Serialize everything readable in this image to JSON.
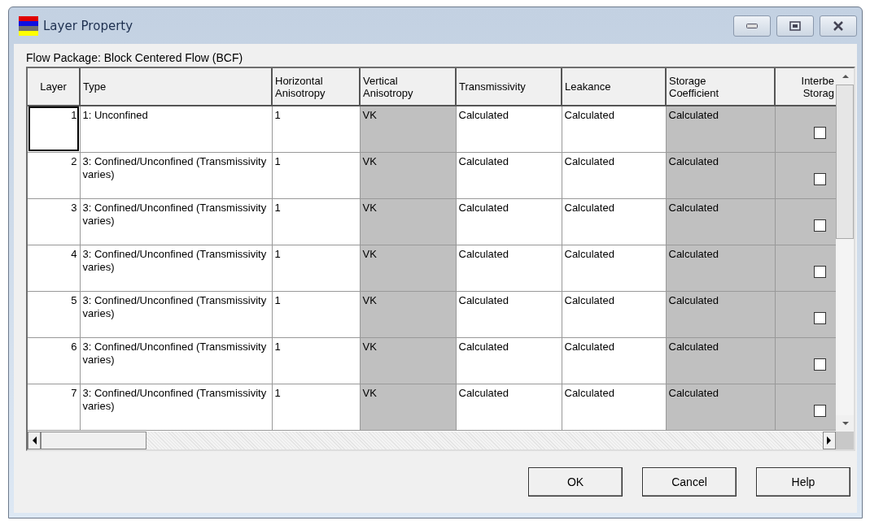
{
  "window": {
    "title": "Layer Property"
  },
  "package_label": "Flow Package: Block Centered Flow (BCF)",
  "table": {
    "columns": [
      {
        "label": "Layer",
        "disabled": false
      },
      {
        "label": "Type",
        "disabled": false
      },
      {
        "label": "Horizontal Anisotropy",
        "disabled": false
      },
      {
        "label": "Vertical Anisotropy",
        "disabled": true
      },
      {
        "label": "Transmissivity",
        "disabled": false
      },
      {
        "label": "Leakance",
        "disabled": false
      },
      {
        "label": "Storage Coefficient",
        "disabled": true
      },
      {
        "label": "Interbe Storag",
        "disabled": true
      }
    ],
    "rows": [
      {
        "layer": "1",
        "focused": true,
        "type": "1: Unconfined",
        "horizontal": "1",
        "vertical": "VK",
        "transmissivity": "Calculated",
        "leakance": "Calculated",
        "storage": "Calculated",
        "interbed": false
      },
      {
        "layer": "2",
        "focused": false,
        "type": "3: Confined/Unconfined (Transmissivity varies)",
        "horizontal": "1",
        "vertical": "VK",
        "transmissivity": "Calculated",
        "leakance": "Calculated",
        "storage": "Calculated",
        "interbed": false
      },
      {
        "layer": "3",
        "focused": false,
        "type": "3: Confined/Unconfined (Transmissivity varies)",
        "horizontal": "1",
        "vertical": "VK",
        "transmissivity": "Calculated",
        "leakance": "Calculated",
        "storage": "Calculated",
        "interbed": false
      },
      {
        "layer": "4",
        "focused": false,
        "type": "3: Confined/Unconfined (Transmissivity varies)",
        "horizontal": "1",
        "vertical": "VK",
        "transmissivity": "Calculated",
        "leakance": "Calculated",
        "storage": "Calculated",
        "interbed": false
      },
      {
        "layer": "5",
        "focused": false,
        "type": "3: Confined/Unconfined (Transmissivity varies)",
        "horizontal": "1",
        "vertical": "VK",
        "transmissivity": "Calculated",
        "leakance": "Calculated",
        "storage": "Calculated",
        "interbed": false
      },
      {
        "layer": "6",
        "focused": false,
        "type": "3: Confined/Unconfined (Transmissivity varies)",
        "horizontal": "1",
        "vertical": "VK",
        "transmissivity": "Calculated",
        "leakance": "Calculated",
        "storage": "Calculated",
        "interbed": false
      },
      {
        "layer": "7",
        "focused": false,
        "type": "3: Confined/Unconfined (Transmissivity varies)",
        "horizontal": "1",
        "vertical": "VK",
        "transmissivity": "Calculated",
        "leakance": "Calculated",
        "storage": "Calculated",
        "interbed": false
      }
    ]
  },
  "buttons": [
    "OK",
    "Cancel",
    "Help"
  ]
}
